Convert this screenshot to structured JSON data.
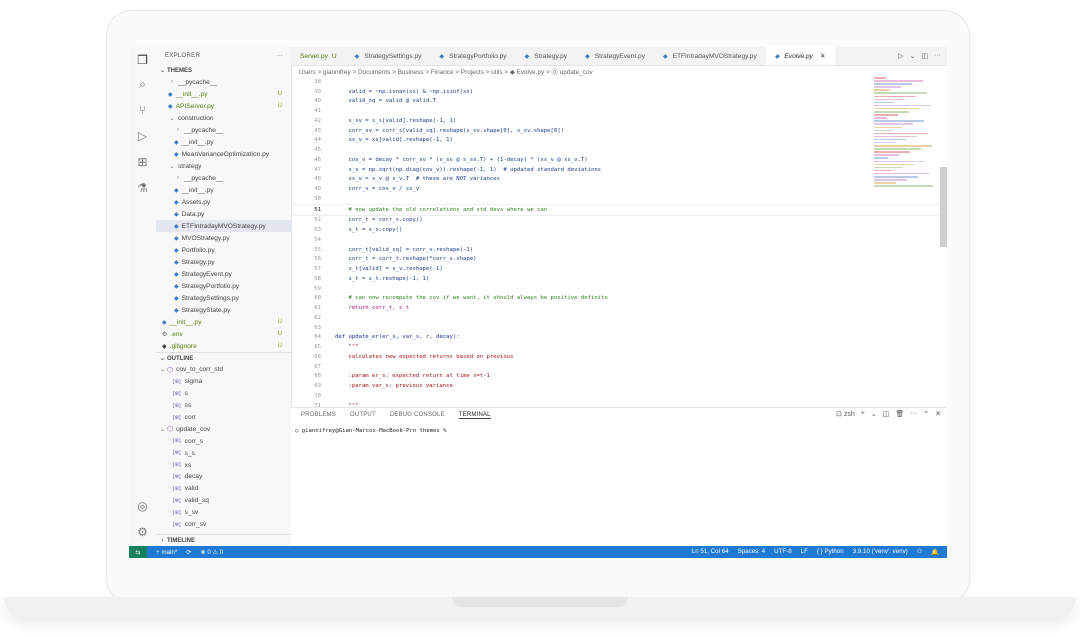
{
  "explorer": {
    "title": "EXPLORER",
    "more": "···",
    "section": "THEMES",
    "tree": [
      {
        "depth": 1,
        "kind": "folder",
        "collapsed": true,
        "label": "__pycache__"
      },
      {
        "depth": 1,
        "kind": "py",
        "label": "__init__.py",
        "git": "U",
        "green": true
      },
      {
        "depth": 1,
        "kind": "py",
        "label": "APIServer.py",
        "git": "U",
        "green": true
      },
      {
        "depth": 1,
        "kind": "folder",
        "collapsed": false,
        "label": "construction"
      },
      {
        "depth": 2,
        "kind": "folder",
        "collapsed": true,
        "label": "__pycache__"
      },
      {
        "depth": 2,
        "kind": "py",
        "label": "__init__.py"
      },
      {
        "depth": 2,
        "kind": "py",
        "label": "MeanVarianceOptimization.py"
      },
      {
        "depth": 1,
        "kind": "folder",
        "collapsed": false,
        "label": "strategy"
      },
      {
        "depth": 2,
        "kind": "folder",
        "collapsed": true,
        "label": "__pycache__"
      },
      {
        "depth": 2,
        "kind": "py",
        "label": "__init__.py"
      },
      {
        "depth": 2,
        "kind": "py",
        "label": "Assets.py"
      },
      {
        "depth": 2,
        "kind": "py",
        "label": "Data.py"
      },
      {
        "depth": 2,
        "kind": "py",
        "label": "ETFIntradayMVOStrategy.py",
        "selected": true
      },
      {
        "depth": 2,
        "kind": "py",
        "label": "MVOStrategy.py"
      },
      {
        "depth": 2,
        "kind": "py",
        "label": "Portfolio.py"
      },
      {
        "depth": 2,
        "kind": "py",
        "label": "Strategy.py"
      },
      {
        "depth": 2,
        "kind": "py",
        "label": "StrategyEvent.py"
      },
      {
        "depth": 2,
        "kind": "py",
        "label": "StrategyPortfolio.py"
      },
      {
        "depth": 2,
        "kind": "py",
        "label": "StrategySettings.py"
      },
      {
        "depth": 2,
        "kind": "py",
        "label": "StrategyState.py"
      },
      {
        "depth": 0,
        "kind": "py",
        "label": "__init__.py",
        "git": "U",
        "green": true
      },
      {
        "depth": 0,
        "kind": "env",
        "label": ".env",
        "git": "U",
        "green": true
      },
      {
        "depth": 0,
        "kind": "git",
        "label": ".gitignore",
        "git": "U",
        "green": true
      }
    ]
  },
  "outline": {
    "title": "OUTLINE",
    "items": [
      {
        "depth": 0,
        "kind": "func",
        "label": "cov_to_corr_std"
      },
      {
        "depth": 1,
        "kind": "var",
        "label": "sigma"
      },
      {
        "depth": 1,
        "kind": "var",
        "label": "s"
      },
      {
        "depth": 1,
        "kind": "var",
        "label": "ss"
      },
      {
        "depth": 1,
        "kind": "var",
        "label": "corr"
      },
      {
        "depth": 0,
        "kind": "func",
        "label": "update_cov"
      },
      {
        "depth": 1,
        "kind": "var",
        "label": "corr_s"
      },
      {
        "depth": 1,
        "kind": "var",
        "label": "s_s"
      },
      {
        "depth": 1,
        "kind": "var",
        "label": "xs"
      },
      {
        "depth": 1,
        "kind": "var",
        "label": "decay"
      },
      {
        "depth": 1,
        "kind": "var",
        "label": "valid"
      },
      {
        "depth": 1,
        "kind": "var",
        "label": "valid_sq"
      },
      {
        "depth": 1,
        "kind": "var",
        "label": "s_sv"
      },
      {
        "depth": 1,
        "kind": "var",
        "label": "corr_sv"
      }
    ]
  },
  "timeline": {
    "title": "TIMELINE"
  },
  "tabs": [
    {
      "label": "Server.py",
      "suffix": "U",
      "green": true
    },
    {
      "label": "StrategySettings.py"
    },
    {
      "label": "StrategyPortfolio.py"
    },
    {
      "label": "Strategy.py"
    },
    {
      "label": "StrategyEvent.py"
    },
    {
      "label": "ETFIntradayMVOStrategy.py"
    },
    {
      "label": "Evolve.py",
      "active": true
    }
  ],
  "breadcrumb": "Users > giannifrey > Documents > Business > Finance > Projects > utils > ◆ Evolve.py > ⓪ update_cov",
  "code": [
    {
      "n": "38",
      "t": ""
    },
    {
      "n": "39",
      "t": "    valid = ~np.isnan(xs) & ~np.isinf(xs)",
      "c": "#1a3a8a"
    },
    {
      "n": "40",
      "t": "    valid_sq = valid @ valid.T",
      "c": "#1a3a8a"
    },
    {
      "n": "41",
      "t": ""
    },
    {
      "n": "42",
      "t": "    s_sv = s_s[valid].reshape(-1, 1)",
      "c": "#1a3a8a"
    },
    {
      "n": "43",
      "t": "    corr_sv = corr_s[valid_sq].reshape(s_sv.shape[0], s_sv.shape[0])",
      "c": "#1a3a8a"
    },
    {
      "n": "44",
      "t": "    xs_v = xs[valid].reshape(-1, 1)",
      "c": "#1a3a8a"
    },
    {
      "n": "45",
      "t": ""
    },
    {
      "n": "46",
      "t": "    cov_v = decay * corr_sv * (s_sv @ s_sv.T) + (1-decay) * (xs_v @ xs_v.T)",
      "c": "#1a3a8a"
    },
    {
      "n": "47",
      "t": "    s_v = np.sqrt(np.diag(cov_v)).reshape(-1, 1)  # updated standard deviations",
      "c": "#1a3a8a"
    },
    {
      "n": "48",
      "t": "    ss_v = s_v @ s_v.T  # these are NOT variances",
      "c": "#1a3a8a"
    },
    {
      "n": "49",
      "t": "    corr_v = cov_v / ss_v",
      "c": "#1a3a8a"
    },
    {
      "n": "50",
      "t": ""
    },
    {
      "n": "51",
      "t": "    # now update the old correlations and std devs where we can",
      "c": "#2f7d1f",
      "current": true
    },
    {
      "n": "52",
      "t": "    corr_t = corr_s.copy()",
      "c": "#1a3a8a"
    },
    {
      "n": "53",
      "t": "    s_t = s_s.copy()",
      "c": "#1a3a8a"
    },
    {
      "n": "54",
      "t": ""
    },
    {
      "n": "55",
      "t": "    corr_t[valid_sq] = corr_v.reshape(-1)",
      "c": "#1a3a8a"
    },
    {
      "n": "56",
      "t": "    corr_t = corr_t.reshape(*corr_s.shape)",
      "c": "#1a3a8a"
    },
    {
      "n": "57",
      "t": "    s_t[valid] = s_v.reshape(-1)",
      "c": "#1a3a8a"
    },
    {
      "n": "58",
      "t": "    s_t = s_t.reshape(-1, 1)",
      "c": "#1a3a8a"
    },
    {
      "n": "59",
      "t": ""
    },
    {
      "n": "60",
      "t": "    # can now recompute the cov if we want, it should always be positive definite",
      "c": "#2f7d1f"
    },
    {
      "n": "61",
      "t": "    return corr_t, s_t",
      "c": "#a3157a"
    },
    {
      "n": "62",
      "t": ""
    },
    {
      "n": "63",
      "t": ""
    },
    {
      "n": "64",
      "t": "def update_er(er_s, var_s, r, decay):",
      "c": "#1c2a9e"
    },
    {
      "n": "65",
      "t": "    \"\"\"",
      "c": "#a31515"
    },
    {
      "n": "66",
      "t": "    calculates new expected returns based on previous",
      "c": "#a31515"
    },
    {
      "n": "67",
      "t": ""
    },
    {
      "n": "68",
      "t": "    :param er_s: expected return at time s=t-1",
      "c": "#a31515"
    },
    {
      "n": "69",
      "t": "    :param var_s: previous variance",
      "c": "#a31515"
    },
    {
      "n": "70",
      "t": ""
    },
    {
      "n": "71",
      "t": "    \"\"\"",
      "c": "#a31515"
    }
  ],
  "panel": {
    "tabs": [
      "PROBLEMS",
      "OUTPUT",
      "DEBUG CONSOLE",
      "TERMINAL"
    ],
    "active": "TERMINAL",
    "shell": "zsh",
    "prompt": "○ giannifrey@Gian-Marcos-MacBook-Pro themes %"
  },
  "status": {
    "branch": "main*",
    "problems": "⊗ 0 ⚠ 0",
    "position": "Ln 51, Col 64",
    "spaces": "Spaces: 4",
    "encoding": "UTF-8",
    "eol": "LF",
    "language": "{ } Python",
    "interpreter": "3.9.10 ('venv': venv)"
  }
}
